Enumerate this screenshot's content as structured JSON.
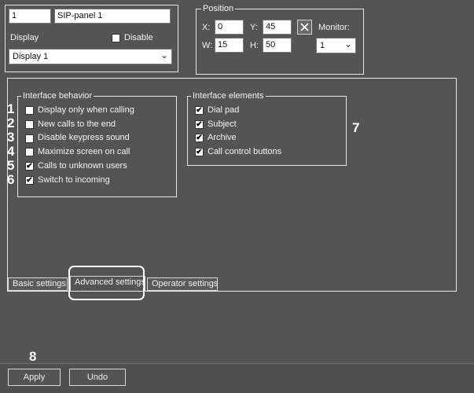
{
  "top": {
    "id_value": "1",
    "name_value": "SIP-panel 1",
    "display_label": "Display",
    "disable_label": "Disable",
    "disable_checked": false,
    "display_select": "Display 1"
  },
  "position": {
    "title": "Position",
    "x_label": "X:",
    "x_value": "0",
    "y_label": "Y:",
    "y_value": "45",
    "w_label": "W:",
    "w_value": "15",
    "h_label": "H:",
    "h_value": "50",
    "monitor_label": "Monitor:",
    "monitor_value": "1",
    "reset_icon": "x-icon"
  },
  "interface_behavior": {
    "title": "Interface behavior",
    "items": [
      {
        "num": "1",
        "label": "Display only when calling",
        "checked": false
      },
      {
        "num": "2",
        "label": "New calls to the end",
        "checked": false
      },
      {
        "num": "3",
        "label": "Disable keypress sound",
        "checked": false
      },
      {
        "num": "4",
        "label": "Maximize screen on call",
        "checked": false
      },
      {
        "num": "5",
        "label": "Calls to unknown users",
        "checked": true
      },
      {
        "num": "6",
        "label": "Switch to incoming",
        "checked": true
      }
    ]
  },
  "interface_elements": {
    "title": "Interface elements",
    "callout": "7",
    "items": [
      {
        "label": "Dial pad",
        "checked": true
      },
      {
        "label": "Subject",
        "checked": true
      },
      {
        "label": "Archive",
        "checked": true
      },
      {
        "label": "Call control buttons",
        "checked": true
      }
    ]
  },
  "tabs": [
    {
      "label": "Basic settings"
    },
    {
      "label": "Advanced settings"
    },
    {
      "label": "Operator settings"
    }
  ],
  "footer": {
    "callout": "8",
    "apply_label": "Apply",
    "undo_label": "Undo"
  },
  "colors": {
    "background": "#545454",
    "highlight": "#ffffff"
  }
}
